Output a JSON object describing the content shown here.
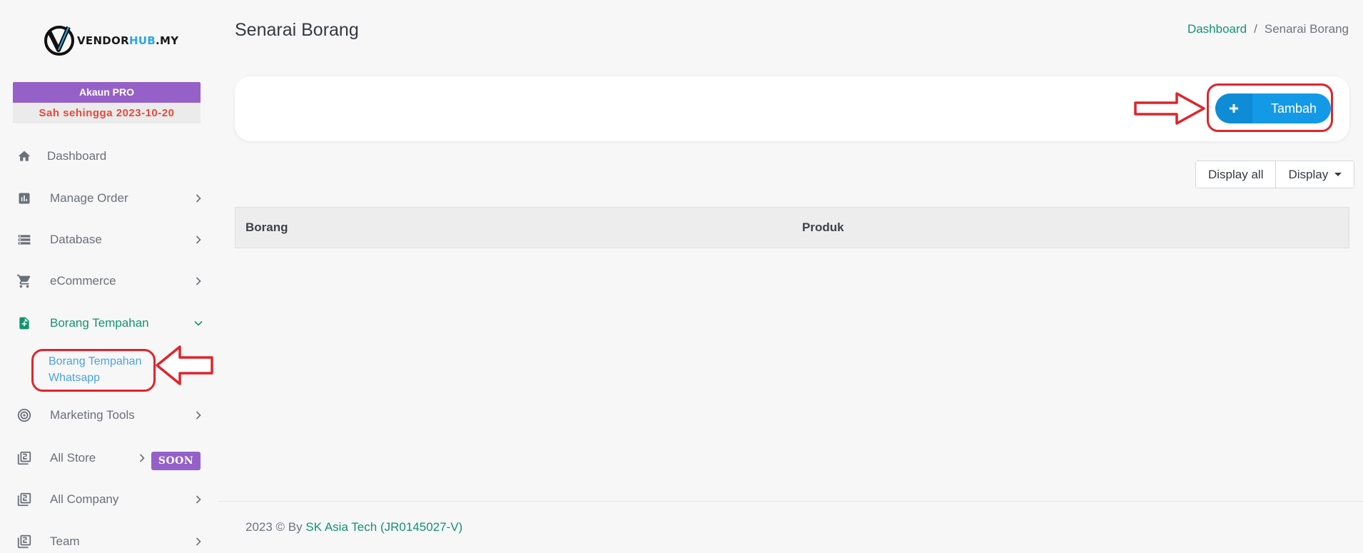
{
  "brand": {
    "logo_icon": "vendorhub-v-logo",
    "name_part1": "VENDOR",
    "name_part2": "HUB",
    "name_part3": ".MY"
  },
  "account": {
    "plan_label": "Akaun PRO",
    "valid_until": "Sah sehingga 2023-10-20"
  },
  "sidebar": {
    "items": [
      {
        "label": "Dashboard",
        "icon": "home-icon",
        "has_chevron": false
      },
      {
        "label": "Manage Order",
        "icon": "chart-icon",
        "has_chevron": true
      },
      {
        "label": "Database",
        "icon": "database-icon",
        "has_chevron": true
      },
      {
        "label": "eCommerce",
        "icon": "cart-icon",
        "has_chevron": true
      },
      {
        "label": "Borang Tempahan",
        "icon": "form-add-icon",
        "has_chevron": true,
        "expanded": true
      },
      {
        "label": "Marketing Tools",
        "icon": "target-icon",
        "has_chevron": true
      },
      {
        "label": "All Store",
        "icon": "library-icon",
        "has_chevron": true,
        "badge": "SOON"
      },
      {
        "label": "All Company",
        "icon": "library-icon",
        "has_chevron": true
      },
      {
        "label": "Team",
        "icon": "library-icon",
        "has_chevron": true
      }
    ],
    "sub_item": "Borang Tempahan Whatsapp"
  },
  "header": {
    "title": "Senarai Borang",
    "breadcrumb": [
      "Dashboard",
      "Senarai Borang"
    ],
    "breadcrumb_sep": "/"
  },
  "toolbar": {
    "add_label": "Tambah",
    "display_all_label": "Display all",
    "display_label": "Display"
  },
  "table": {
    "columns": [
      "Borang",
      "Produk"
    ],
    "rows": []
  },
  "footer": {
    "prefix": "2023 © By ",
    "company": "SK Asia Tech (JR0145027-V)"
  },
  "colors": {
    "accent_green": "#13936e",
    "primary_blue": "#1499e6",
    "pro_purple": "#9561c9",
    "annotation_red": "#e0242a"
  }
}
